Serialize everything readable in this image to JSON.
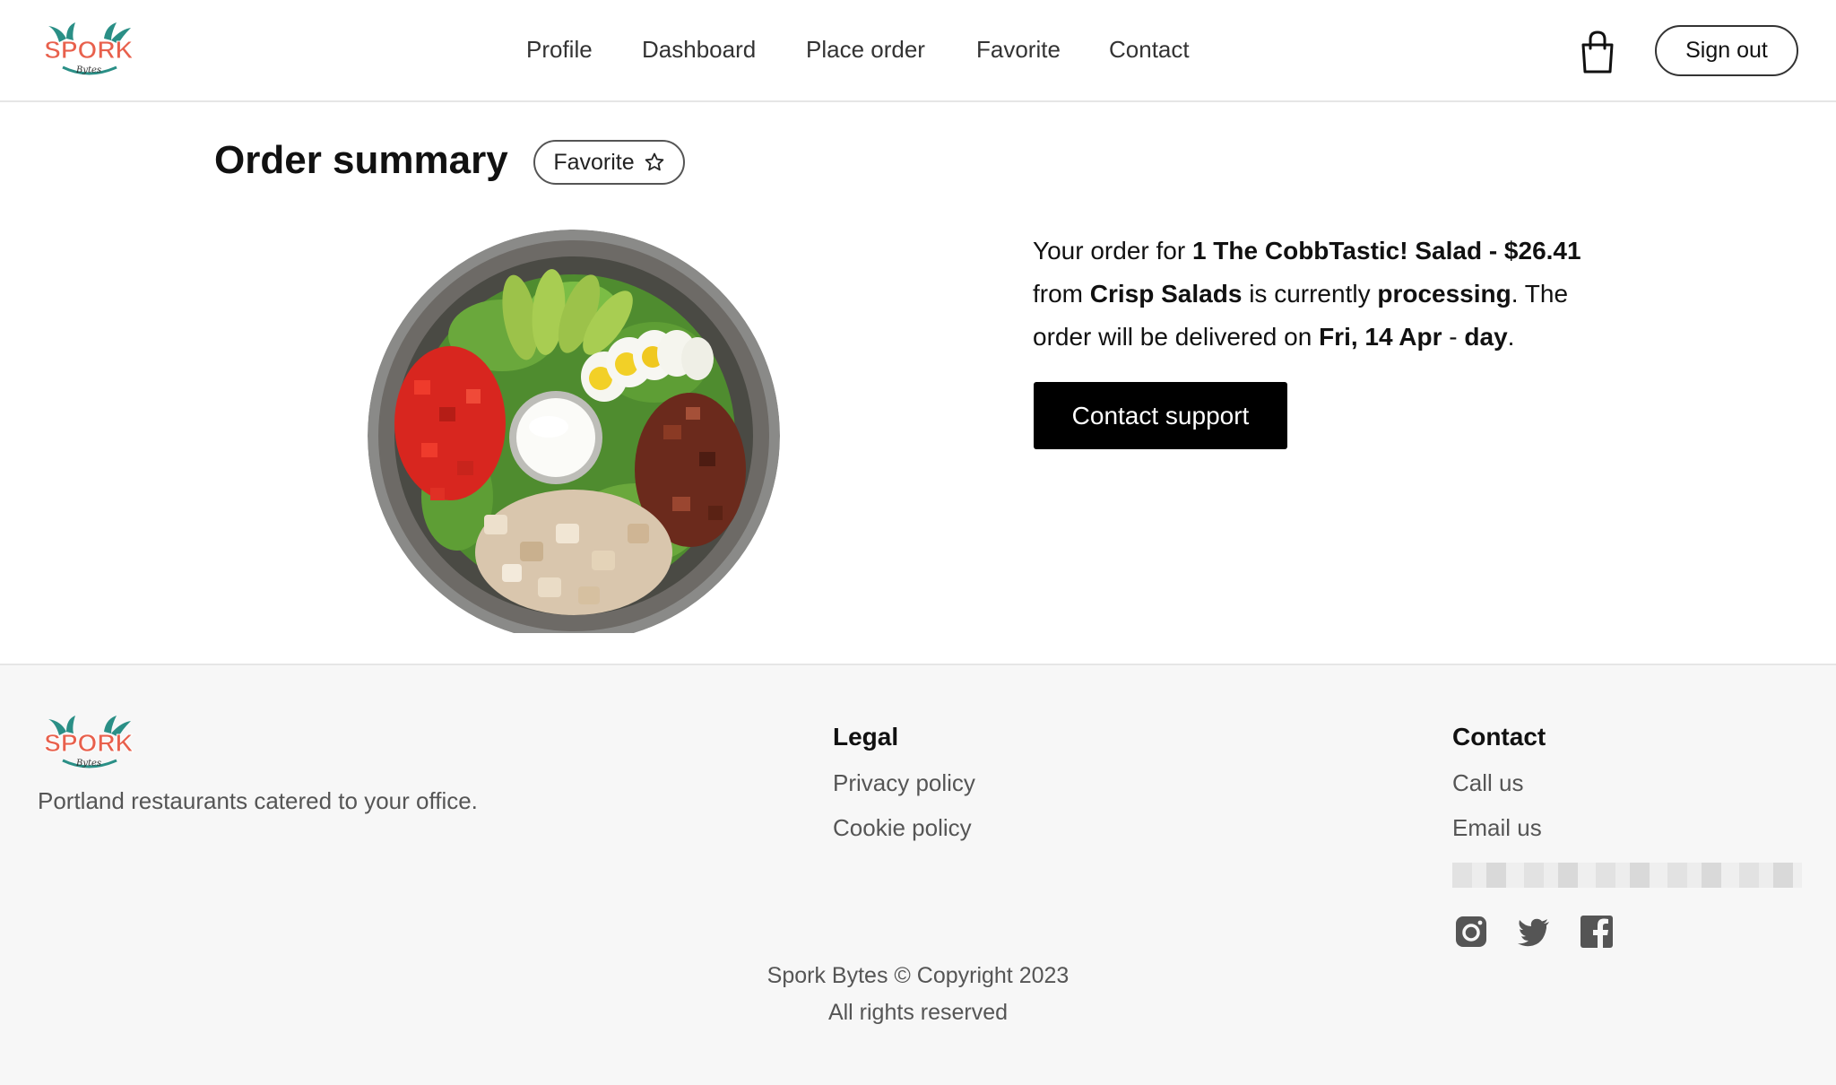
{
  "brand": {
    "logo_text": "SPORK",
    "logo_subtext": "Bytes",
    "logo_red": "#e8604c",
    "logo_teal": "#2a8f86"
  },
  "nav": {
    "items": [
      "Profile",
      "Dashboard",
      "Place order",
      "Favorite",
      "Contact"
    ],
    "cart_icon": "shopping-bag-icon",
    "signout_label": "Sign out"
  },
  "main": {
    "title": "Order summary",
    "favorite_label": "Favorite",
    "favorite_icon": "star-outline-icon",
    "image_alt": "Cobb salad in a metal bowl",
    "summary": {
      "p1": "Your order for ",
      "item": "1 The CobbTastic! Salad - $26.41",
      "p2": " from ",
      "restaurant": "Crisp Salads",
      "p3": " is currently ",
      "status": "processing",
      "p4": ". The order will be delivered on ",
      "date": "Fri, 14 Apr",
      "p5": " - ",
      "time": "day",
      "p6": "."
    },
    "support_label": "Contact support"
  },
  "footer": {
    "tagline": "Portland restaurants catered to your office.",
    "legal": {
      "heading": "Legal",
      "links": [
        "Privacy policy",
        "Cookie policy"
      ]
    },
    "contact": {
      "heading": "Contact",
      "links": [
        "Call us",
        "Email us"
      ]
    },
    "social_icons": [
      "instagram-icon",
      "twitter-icon",
      "facebook-icon"
    ],
    "copyright": "Spork Bytes © Copyright 2023",
    "rights": "All rights reserved"
  }
}
